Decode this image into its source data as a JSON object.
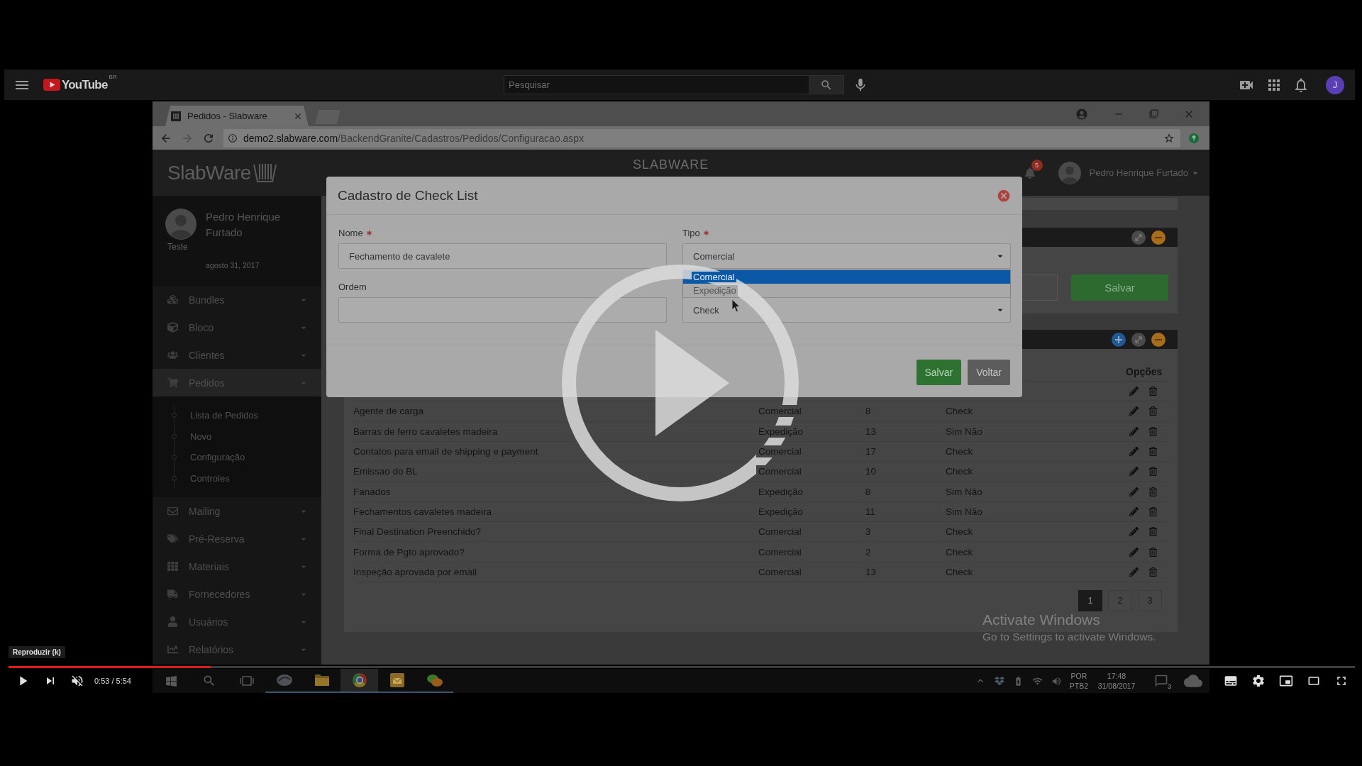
{
  "masthead": {
    "logo_text": "YouTube",
    "region": "BR",
    "search": {
      "placeholder": "Pesquisar"
    },
    "avatar": "J"
  },
  "browser": {
    "tab": {
      "title": "Pedidos - Slabware"
    },
    "url": {
      "host": "demo2.slabware.com",
      "path": "/BackendGranite/Cadastros/Pedidos/Configuracao.aspx"
    }
  },
  "app": {
    "logo": "SlabWare",
    "title": "SLABWARE",
    "notifications": "5",
    "user": "Pedro Henrique Furtado"
  },
  "sidebar": {
    "profile": {
      "name": "Pedro Henrique Furtado",
      "role": "Teste",
      "date": "agosto 31, 2017"
    },
    "items": [
      {
        "label": "Bundles",
        "selected": false
      },
      {
        "label": "Bloco",
        "selected": false
      },
      {
        "label": "Clientes",
        "selected": false
      },
      {
        "label": "Pedidos",
        "selected": true,
        "children": [
          {
            "label": "Lista de Pedidos"
          },
          {
            "label": "Novo"
          },
          {
            "label": "Configuração"
          },
          {
            "label": "Controles"
          }
        ]
      },
      {
        "label": "Mailing",
        "selected": false
      },
      {
        "label": "Pré-Reserva",
        "selected": false
      },
      {
        "label": "Materiais",
        "selected": false
      },
      {
        "label": "Fornecedores",
        "selected": false
      },
      {
        "label": "Usuários",
        "selected": false
      },
      {
        "label": "Relatórios",
        "selected": false
      }
    ]
  },
  "form_panel": {
    "button": "Salvar"
  },
  "table": {
    "options_heading": "Opções",
    "covered_row": true,
    "rows": [
      {
        "cells": [
          "Agente de carga",
          "Comercial",
          "8",
          "Check"
        ]
      },
      {
        "cells": [
          "Barras de ferro cavaletes madeira",
          "Expedição",
          "13",
          "Sim Não"
        ]
      },
      {
        "cells": [
          "Contatos para email de shipping e payment",
          "Comercial",
          "17",
          "Check"
        ]
      },
      {
        "cells": [
          "Emissao do BL",
          "Comercial",
          "10",
          "Check"
        ]
      },
      {
        "cells": [
          "Fanados",
          "Expedição",
          "8",
          "Sim Não"
        ]
      },
      {
        "cells": [
          "Fechamentos cavaletes madeira",
          "Expedição",
          "11",
          "Sim Não"
        ]
      },
      {
        "cells": [
          "Final Destination Preenchido?",
          "Comercial",
          "3",
          "Check"
        ]
      },
      {
        "cells": [
          "Forma de Pgto aprovado?",
          "Comercial",
          "2",
          "Check"
        ]
      },
      {
        "cells": [
          "Inspeção aprovada por email",
          "Comercial",
          "13",
          "Check"
        ]
      }
    ],
    "pages": [
      {
        "label": "1",
        "selected": true
      },
      {
        "label": "2",
        "selected": false
      },
      {
        "label": "3",
        "selected": false
      }
    ]
  },
  "modal": {
    "title": "Cadastro de Check List",
    "fields": [
      {
        "kind": "input",
        "label": "Nome",
        "required": true,
        "value": "Fechamento de cavalete"
      },
      {
        "kind": "select",
        "label": "Tipo",
        "required": true,
        "value": "Comercial",
        "options": [
          {
            "label": "Comercial",
            "selected": true
          },
          {
            "label": "Expedição",
            "selected": false
          }
        ]
      },
      {
        "kind": "input",
        "label": "Ordem"
      },
      {
        "kind": "select",
        "value": "Check"
      }
    ],
    "buttons": [
      {
        "kind": "primary",
        "label": "Salvar"
      },
      {
        "kind": "secondary",
        "label": "Voltar"
      }
    ]
  },
  "system_notice": {
    "title": "Activate Windows",
    "text": "Go to Settings to activate Windows."
  },
  "taskbar": {
    "language": "POR",
    "layout": "PTB2",
    "time": "17:48",
    "date": "31/08/2017",
    "notifications": "3"
  },
  "player": {
    "paused": true,
    "muted": true,
    "level": 0.15,
    "time": "0:53 / 5:54",
    "tooltip": "Reproduzir (k)"
  }
}
